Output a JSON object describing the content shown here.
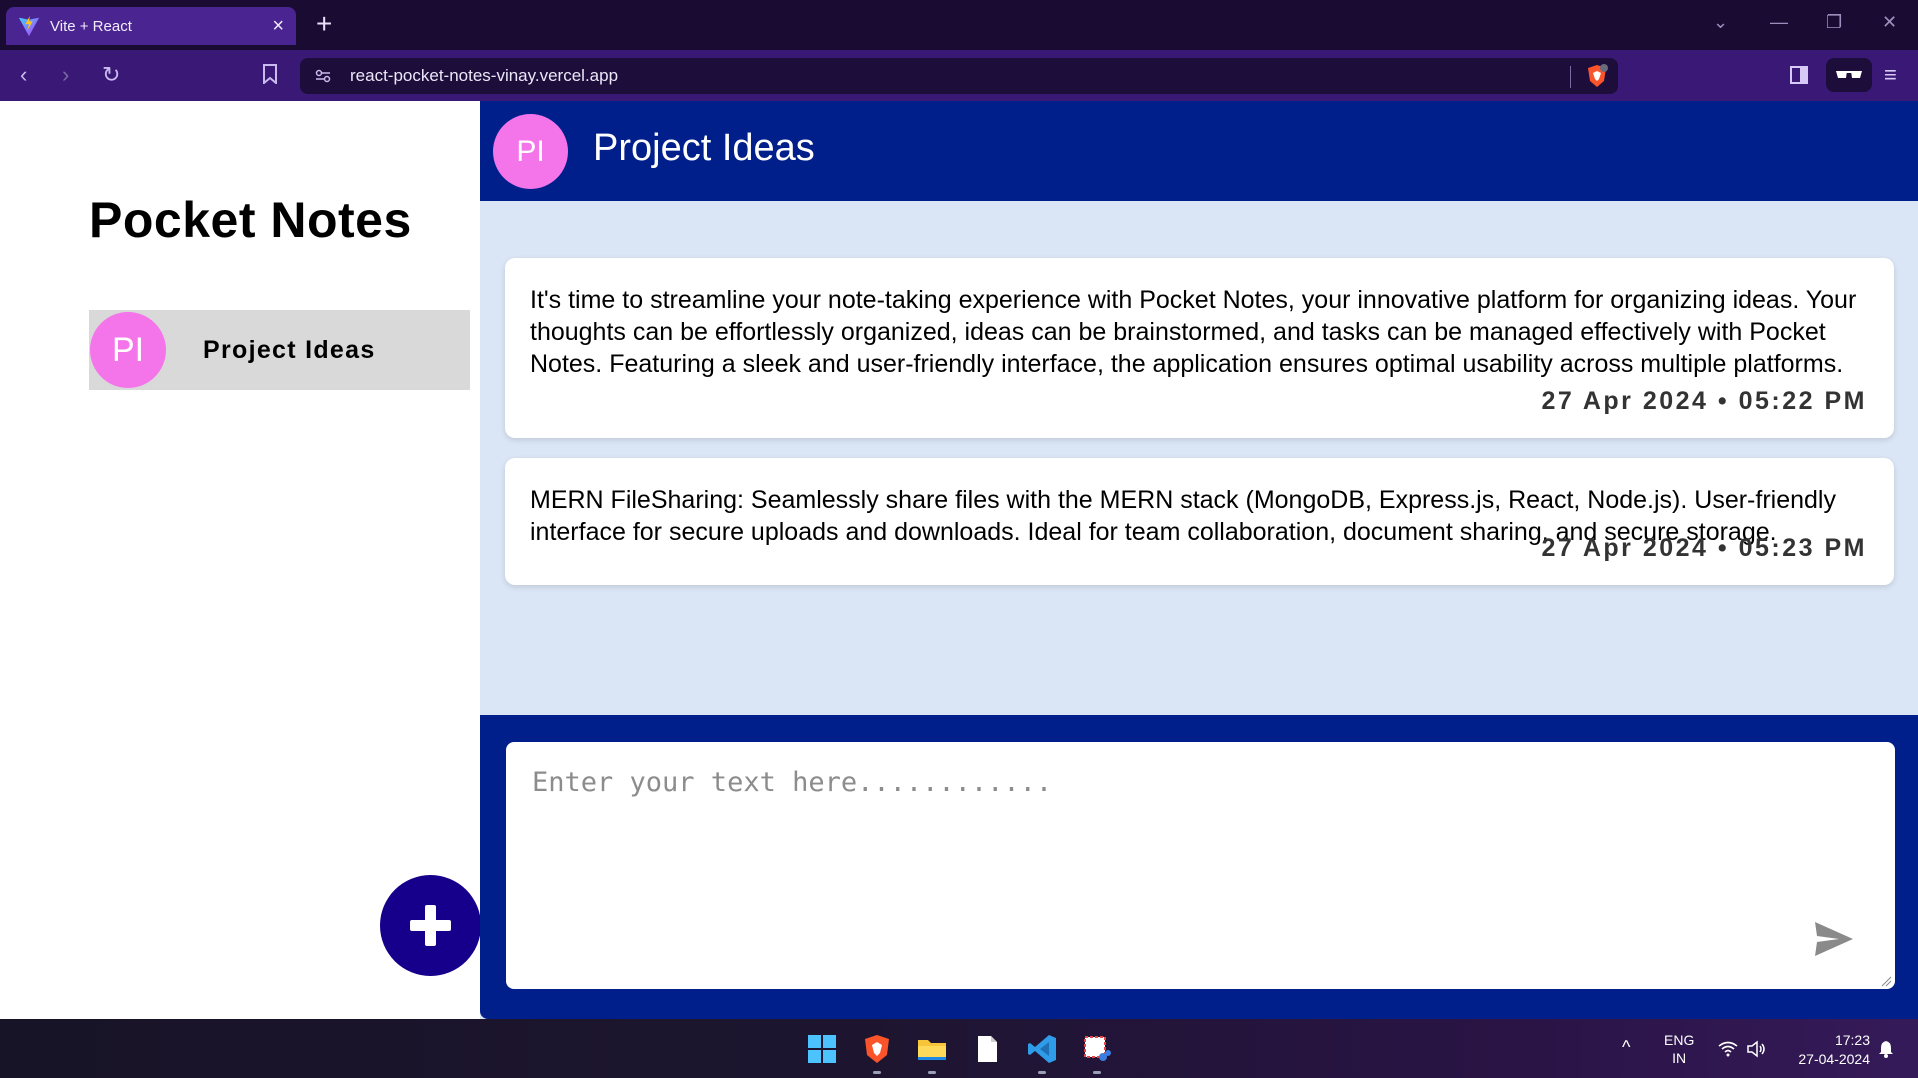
{
  "browser": {
    "tab_title": "Vite + React",
    "url": "react-pocket-notes-vinay.vercel.app"
  },
  "sidebar": {
    "app_title": "Pocket Notes",
    "groups": [
      {
        "initials": "PI",
        "name": "Project Ideas",
        "color": "#f474e9"
      }
    ]
  },
  "chat": {
    "initials": "PI",
    "title": "Project Ideas",
    "notes": [
      {
        "text": "It's time to streamline your note-taking experience with Pocket Notes, your innovative platform for organizing ideas. Your thoughts can be effortlessly organized, ideas can be brainstormed, and tasks can be managed effectively with Pocket Notes. Featuring a sleek and user-friendly interface, the application ensures optimal usability across multiple platforms.",
        "date": "27 Apr 2024",
        "time": "05:22 PM"
      },
      {
        "text": "MERN FileSharing: Seamlessly share files with the MERN stack (MongoDB, Express.js, React, Node.js). User-friendly interface for secure uploads and downloads. Ideal for team collaboration, document sharing, and secure storage.",
        "date": "27 Apr 2024",
        "time": "05:23 PM"
      }
    ],
    "input_placeholder": "Enter your text here............"
  },
  "taskbar": {
    "lang": "ENG",
    "region": "IN",
    "time": "17:23",
    "date": "27-04-2024"
  },
  "colors": {
    "accent": "#001f8b",
    "fab": "#16008b",
    "avatar": "#f474e9",
    "background": "#dae5f5"
  }
}
